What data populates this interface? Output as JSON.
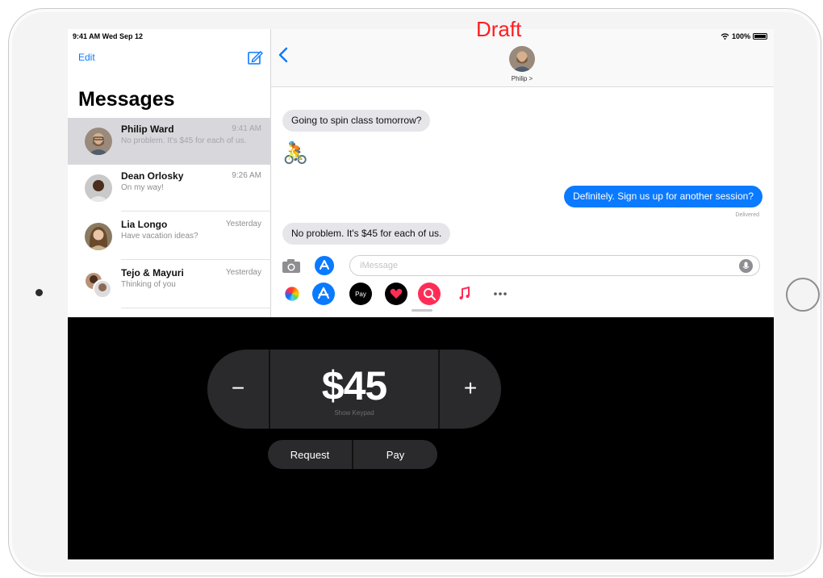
{
  "watermark": "Draft",
  "status": {
    "time": "9:41 AM  Wed Sep 12",
    "battery": "100%"
  },
  "sidebar": {
    "edit": "Edit",
    "title": "Messages",
    "conversations": [
      {
        "name": "Philip Ward",
        "time": "9:41 AM",
        "preview": "No problem. It's $45 for each of us."
      },
      {
        "name": "Dean Orlosky",
        "time": "9:26 AM",
        "preview": "On my way!"
      },
      {
        "name": "Lia Longo",
        "time": "Yesterday",
        "preview": "Have vacation ideas?"
      },
      {
        "name": "Tejo & Mayuri",
        "time": "Yesterday",
        "preview": "Thinking of you"
      }
    ]
  },
  "chat": {
    "contact": "Philip >",
    "messages": {
      "incoming_1": "Going to spin class tomorrow?",
      "emoji": "🚴",
      "outgoing_1": "Definitely. Sign us up for another session?",
      "incoming_2": "No problem. It's $45 for each of us."
    },
    "delivered": "Delivered",
    "input_placeholder": "iMessage"
  },
  "drawer_apps": [
    "photos-app",
    "app-store-app",
    "apple-pay-app",
    "digital-touch-app",
    "image-search-app",
    "music-app",
    "more-apps"
  ],
  "apple_pay_label": "Pay",
  "pay": {
    "amount": "$45",
    "keypad_label": "Show Keypad",
    "minus": "−",
    "plus": "+",
    "request": "Request",
    "pay": "Pay"
  },
  "colors": {
    "accent": "#0a7aff",
    "draft": "#ff1e1e",
    "bubble_in": "#e6e6ea"
  }
}
